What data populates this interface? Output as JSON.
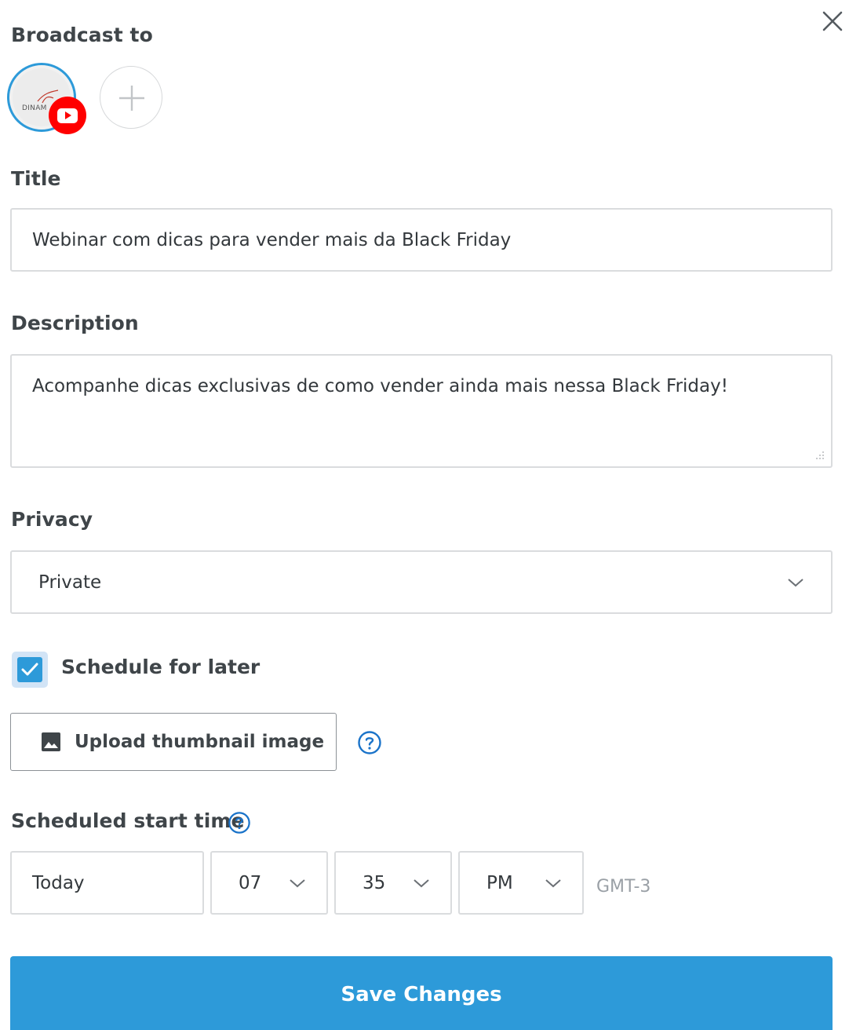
{
  "dialog": {
    "close_icon": "close-icon"
  },
  "broadcast": {
    "label": "Broadcast to",
    "destination": {
      "logo_text": "DINAM",
      "platform": "youtube-icon",
      "accent": "#2d9ad9"
    },
    "add_icon": "plus-icon"
  },
  "title": {
    "label": "Title",
    "value": "Webinar com dicas para vender mais da Black Friday"
  },
  "description": {
    "label": "Description",
    "value": "Acompanhe dicas exclusivas de como vender ainda mais nessa Black Friday!"
  },
  "privacy": {
    "label": "Privacy",
    "selected": "Private"
  },
  "schedule": {
    "label": "Schedule for later",
    "checked": true
  },
  "thumbnail": {
    "button_label": "Upload thumbnail image",
    "icon": "image-icon",
    "help_icon": "help-circle-icon"
  },
  "start_time": {
    "label": "Scheduled start time",
    "day": "Today",
    "hour": "07",
    "minute": "35",
    "period": "PM",
    "timezone": "GMT-3"
  },
  "footer": {
    "save_label": "Save Changes",
    "color": "#2d9ad9"
  }
}
